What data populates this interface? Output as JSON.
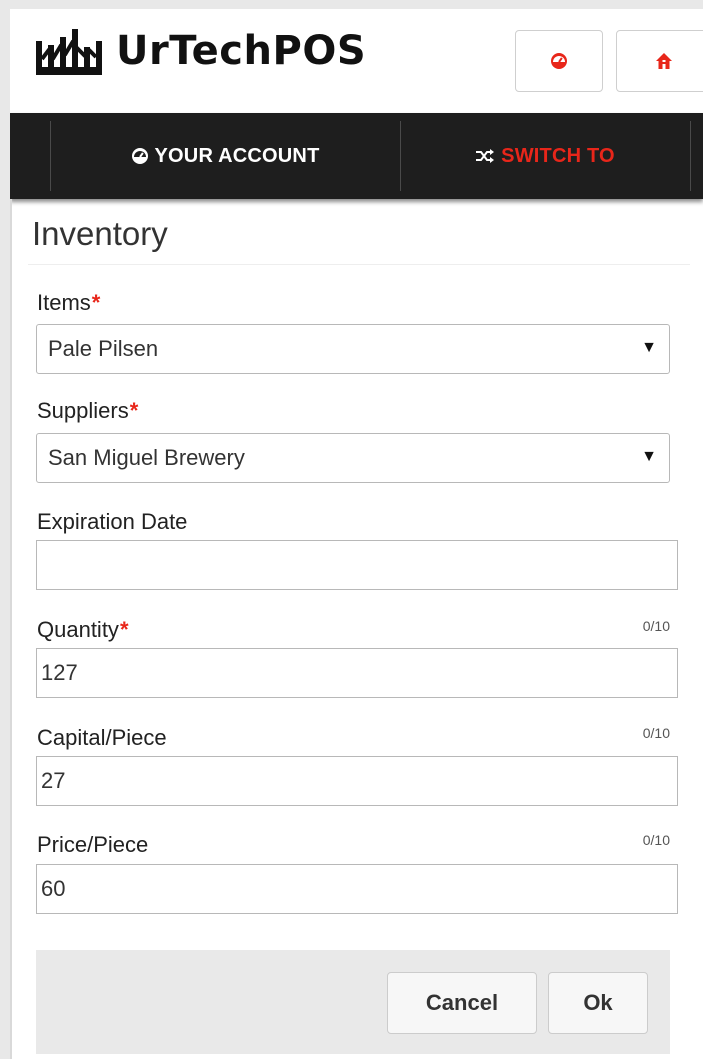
{
  "app": {
    "title": "UrTechPOS"
  },
  "header": {
    "buttons": [
      {
        "icon": "dashboard-icon",
        "color": "#e8261a"
      },
      {
        "icon": "home-icon",
        "color": "#e8261a"
      }
    ]
  },
  "nav": {
    "account_label": "YOUR ACCOUNT",
    "account_icon": "dashboard-icon",
    "switch_label": "SWITCH TO",
    "switch_icon": "shuffle-icon",
    "switch_color": "#e8261a"
  },
  "page": {
    "title": "Inventory"
  },
  "form": {
    "items": {
      "label": "Items",
      "required_mark": "*",
      "value": "Pale Pilsen"
    },
    "suppliers": {
      "label": "Suppliers",
      "required_mark": "*",
      "value": "San Miguel Brewery"
    },
    "expiration": {
      "label": "Expiration Date",
      "value": ""
    },
    "quantity": {
      "label": "Quantity",
      "required_mark": "*",
      "counter": "0/10",
      "value": "127"
    },
    "capital": {
      "label": "Capital/Piece",
      "counter": "0/10",
      "value": "27"
    },
    "price": {
      "label": "Price/Piece",
      "counter": "0/10",
      "value": "60"
    }
  },
  "actions": {
    "cancel_label": "Cancel",
    "ok_label": "Ok"
  }
}
